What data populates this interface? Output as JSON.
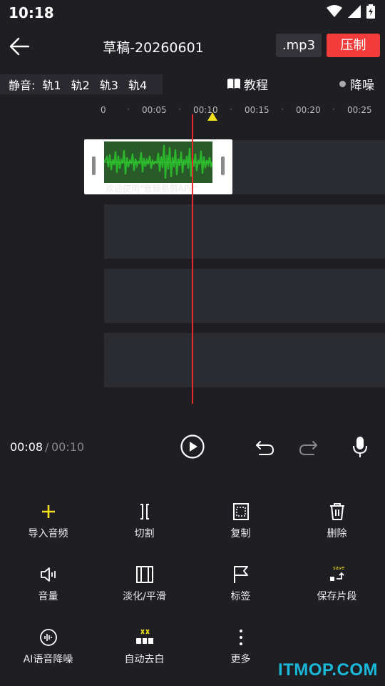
{
  "status": {
    "time": "10:18"
  },
  "header": {
    "title": "草稿-20260601",
    "format_label": ".mp3",
    "export_label": "压制"
  },
  "track_bar": {
    "mute_label": "静音:",
    "tracks": [
      "轨1",
      "轨2",
      "轨3",
      "轨4"
    ]
  },
  "tutorial_label": "教程",
  "denoise_label": "降噪",
  "ruler": {
    "ticks": [
      "0",
      "00:05",
      "00:10",
      "00:15",
      "00:20",
      "00:25"
    ]
  },
  "clip": {
    "caption": "欢迎使用\"音频易剪APP\""
  },
  "playback": {
    "current": "00:08",
    "separator": "/",
    "total": "00:10"
  },
  "tools": [
    {
      "label": "导入音频",
      "icon": "plus-icon"
    },
    {
      "label": "切割",
      "icon": "cut-icon"
    },
    {
      "label": "复制",
      "icon": "copy-icon"
    },
    {
      "label": "删除",
      "icon": "trash-icon"
    },
    {
      "label": "音量",
      "icon": "volume-icon"
    },
    {
      "label": "淡化/平滑",
      "icon": "fade-icon"
    },
    {
      "label": "标签",
      "icon": "flag-icon"
    },
    {
      "label": "保存片段",
      "icon": "save-segment-icon"
    },
    {
      "label": "AI语音降噪",
      "icon": "ai-denoise-icon"
    },
    {
      "label": "自动去白",
      "icon": "auto-trim-icon"
    },
    {
      "label": "更多",
      "icon": "more-icon"
    }
  ],
  "save_icon_text": "save",
  "watermark": "ITMOP.COM",
  "colors": {
    "accent_red": "#f23b3b",
    "playhead_yellow": "#f0e020",
    "wave_green": "#2ab52a",
    "plus_yellow": "#f0e020"
  }
}
